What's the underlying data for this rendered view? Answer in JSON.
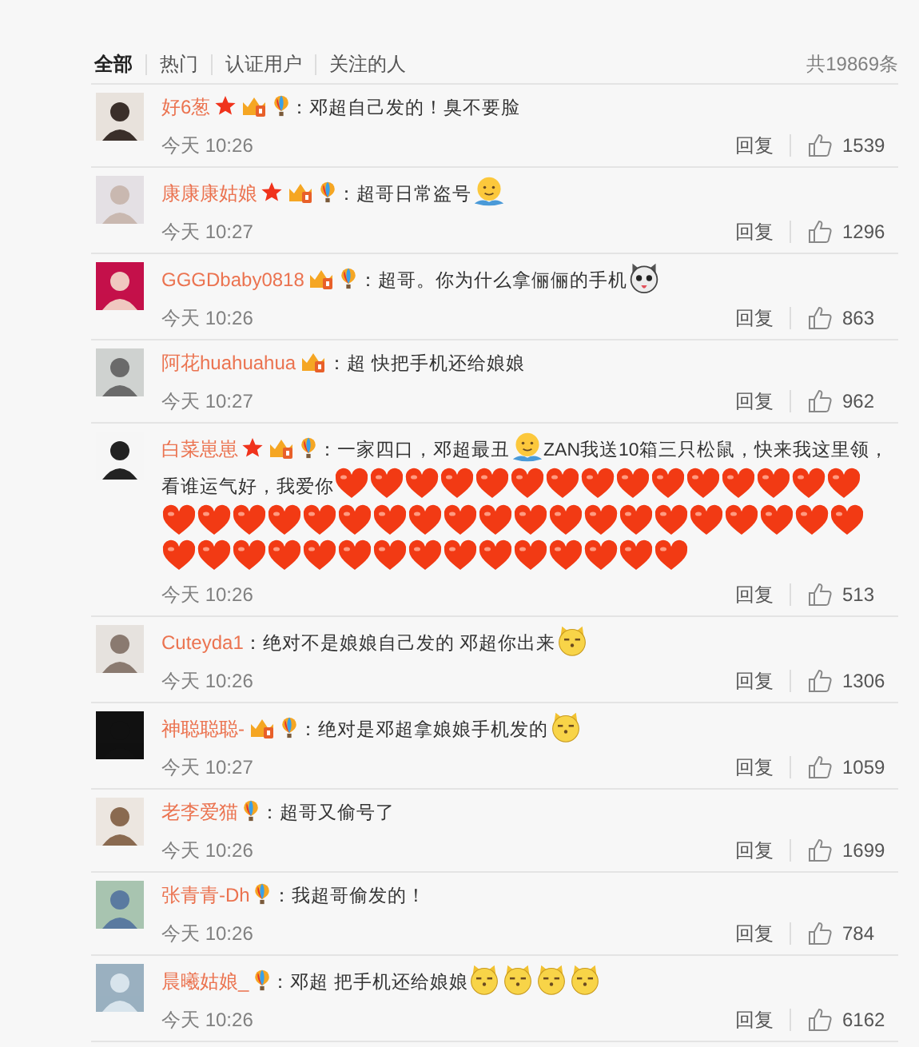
{
  "filters": [
    {
      "label": "全部",
      "selected": true
    },
    {
      "label": "热门",
      "selected": false
    },
    {
      "label": "认证用户",
      "selected": false
    },
    {
      "label": "关注的人",
      "selected": false
    }
  ],
  "total": "共19869条",
  "comments": [
    {
      "avatar": {
        "kind": "picture"
      },
      "name": "好6葱",
      "badges": [
        {
          "kind": "star"
        },
        {
          "kind": "vip"
        },
        {
          "kind": "balloon"
        }
      ],
      "content": [
        {
          "kind": "text",
          "text": "：邓超自己发的！臭不要脸"
        }
      ],
      "time": "今天 10:26",
      "reply": "回复",
      "likes": "1539"
    },
    {
      "avatar": {
        "kind": "picture"
      },
      "name": "康康康姑娘",
      "badges": [
        {
          "kind": "star"
        },
        {
          "kind": "vip"
        },
        {
          "kind": "balloon"
        }
      ],
      "content": [
        {
          "kind": "text",
          "text": "：超哥日常盗号"
        },
        {
          "kind": "hug"
        }
      ],
      "time": "今天 10:27",
      "reply": "回复",
      "likes": "1296"
    },
    {
      "avatar": {
        "kind": "picture"
      },
      "name": "GGGDbaby0818",
      "badges": [
        {
          "kind": "vip"
        },
        {
          "kind": "balloon"
        }
      ],
      "content": [
        {
          "kind": "text",
          "text": "：超哥。你为什么拿俪俪的手机"
        },
        {
          "kind": "husky"
        }
      ],
      "time": "今天 10:26",
      "reply": "回复",
      "likes": "863"
    },
    {
      "avatar": {
        "kind": "picture"
      },
      "name": "阿花huahuahua",
      "badges": [
        {
          "kind": "vip"
        }
      ],
      "content": [
        {
          "kind": "text",
          "text": "：超 快把手机还给娘娘"
        }
      ],
      "time": "今天 10:27",
      "reply": "回复",
      "likes": "962"
    },
    {
      "avatar": {
        "kind": "picture"
      },
      "name": "白菜崽崽",
      "badges": [
        {
          "kind": "star"
        },
        {
          "kind": "vip"
        },
        {
          "kind": "balloon"
        }
      ],
      "content": [
        {
          "kind": "text",
          "text": "：一家四口，邓超最丑"
        },
        {
          "kind": "hug"
        },
        {
          "kind": "text",
          "text": "ZAN我送10箱三只松鼠，快来我这里领，"
        },
        {
          "kind": "text",
          "text": "看谁运气好，我爱你"
        },
        {
          "kind": "heart"
        },
        {
          "kind": "heart"
        },
        {
          "kind": "heart"
        },
        {
          "kind": "heart"
        },
        {
          "kind": "heart"
        },
        {
          "kind": "heart"
        },
        {
          "kind": "heart"
        },
        {
          "kind": "heart"
        },
        {
          "kind": "heart"
        },
        {
          "kind": "heart"
        },
        {
          "kind": "heart"
        },
        {
          "kind": "heart"
        },
        {
          "kind": "heart"
        },
        {
          "kind": "heart"
        },
        {
          "kind": "heart"
        },
        {
          "kind": "heart"
        },
        {
          "kind": "heart"
        },
        {
          "kind": "heart"
        },
        {
          "kind": "heart"
        },
        {
          "kind": "heart"
        },
        {
          "kind": "heart"
        },
        {
          "kind": "heart"
        },
        {
          "kind": "heart"
        },
        {
          "kind": "heart"
        },
        {
          "kind": "heart"
        },
        {
          "kind": "heart"
        },
        {
          "kind": "heart"
        },
        {
          "kind": "heart"
        },
        {
          "kind": "heart"
        },
        {
          "kind": "heart"
        },
        {
          "kind": "heart"
        },
        {
          "kind": "heart"
        },
        {
          "kind": "heart"
        },
        {
          "kind": "heart"
        },
        {
          "kind": "heart"
        },
        {
          "kind": "heart"
        },
        {
          "kind": "heart"
        },
        {
          "kind": "heart"
        },
        {
          "kind": "heart"
        },
        {
          "kind": "heart"
        },
        {
          "kind": "heart"
        },
        {
          "kind": "heart"
        },
        {
          "kind": "heart"
        },
        {
          "kind": "heart"
        },
        {
          "kind": "heart"
        },
        {
          "kind": "heart"
        },
        {
          "kind": "heart"
        },
        {
          "kind": "heart"
        },
        {
          "kind": "heart"
        },
        {
          "kind": "heart"
        }
      ],
      "time": "今天 10:26",
      "reply": "回复",
      "likes": "513"
    },
    {
      "avatar": {
        "kind": "picture"
      },
      "name": "Cuteyda1",
      "content": [
        {
          "kind": "text",
          "text": "：绝对不是娘娘自己发的 邓超你出来"
        },
        {
          "kind": "doge"
        }
      ],
      "time": "今天 10:26",
      "reply": "回复",
      "likes": "1306"
    },
    {
      "avatar": {
        "kind": "picture"
      },
      "name": "神聪聪聪-",
      "badges": [
        {
          "kind": "vip"
        },
        {
          "kind": "balloon"
        }
      ],
      "content": [
        {
          "kind": "text",
          "text": "：绝对是邓超拿娘娘手机发的"
        },
        {
          "kind": "doge"
        }
      ],
      "time": "今天 10:27",
      "reply": "回复",
      "likes": "1059"
    },
    {
      "avatar": {
        "kind": "picture"
      },
      "name": "老李爱猫",
      "badges": [
        {
          "kind": "balloon"
        }
      ],
      "content": [
        {
          "kind": "text",
          "text": "：超哥又偷号了"
        }
      ],
      "time": "今天 10:26",
      "reply": "回复",
      "likes": "1699"
    },
    {
      "avatar": {
        "kind": "picture"
      },
      "name": "张青青-Dh",
      "badges": [
        {
          "kind": "balloon"
        }
      ],
      "content": [
        {
          "kind": "text",
          "text": "：我超哥偷发的！"
        }
      ],
      "time": "今天 10:26",
      "reply": "回复",
      "likes": "784"
    },
    {
      "avatar": {
        "kind": "picture"
      },
      "name": "晨曦姑娘_",
      "badges": [
        {
          "kind": "balloon"
        }
      ],
      "content": [
        {
          "kind": "text",
          "text": "：邓超 把手机还给娘娘"
        },
        {
          "kind": "doge"
        },
        {
          "kind": "doge"
        },
        {
          "kind": "doge"
        },
        {
          "kind": "doge"
        }
      ],
      "time": "今天 10:26",
      "reply": "回复",
      "likes": "6162"
    }
  ]
}
